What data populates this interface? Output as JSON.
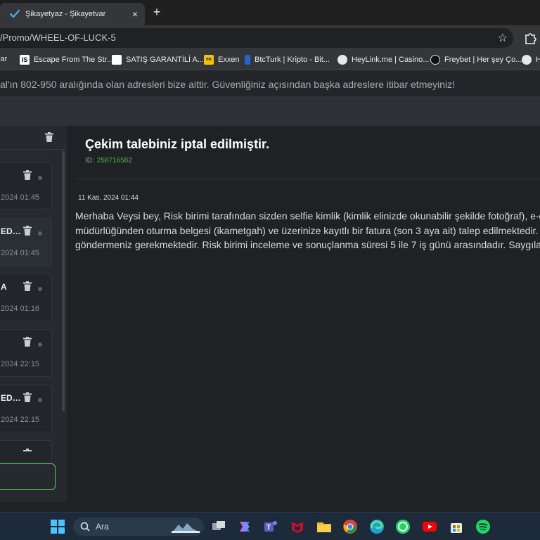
{
  "browser": {
    "tab_title": "Şikayetyaz - Şikayetvar",
    "tab_close": "×",
    "new_tab": "+",
    "url": "/Promo/WHEEL-OF-LUCK-5",
    "star": "☆"
  },
  "bookmarks": [
    {
      "label": "lar",
      "icon": "none"
    },
    {
      "label": "Escape From The Str...",
      "icon": "IS",
      "icon_bg": "#ffffff",
      "icon_fg": "#111111"
    },
    {
      "label": "SATIŞ GARANTİLİ A...",
      "icon": "",
      "icon_bg": "#ffffff",
      "icon_fg": "#111111"
    },
    {
      "label": "Exxen",
      "icon": "ex",
      "icon_bg": "#f2c500",
      "icon_fg": "#111111"
    },
    {
      "label": "BtcTurk | Kripto - Bit...",
      "icon": "",
      "icon_bg": "#2563c9",
      "icon_fg": "#ffffff"
    },
    {
      "label": "HeyLink.me | Casino...",
      "icon": "",
      "icon_bg": "#e8e8e8",
      "icon_fg": "#111111"
    },
    {
      "label": "Freybet | Her şey Ço...",
      "icon": "",
      "icon_bg": "#111111",
      "icon_fg": "#ffffff"
    },
    {
      "label": "H",
      "icon": "",
      "icon_bg": "#e8e8e8",
      "icon_fg": "#111111"
    }
  ],
  "notice": "al'ın 802-950 aralığında olan adresleri bize aittir. Güvenliğiniz açısından başka adreslere itibar etmeyiniz!",
  "sidebar": {
    "items": [
      {
        "title": "",
        "time": "2024 01:45",
        "active": false
      },
      {
        "title": "ED…",
        "time": "2024 01:45",
        "active": true
      },
      {
        "title": "A",
        "time": "2024 01:16",
        "active": false
      },
      {
        "title": "",
        "time": "2024 22:15",
        "active": false
      },
      {
        "title": "ED…",
        "time": "2024 22:15",
        "active": false
      },
      {
        "title": "",
        "time": "",
        "active": false
      }
    ]
  },
  "ticket": {
    "subject": "Çekim talebiniz iptal edilmiştir.",
    "id_label": "ID:",
    "id_value": "258716582",
    "date": "11 Kas, 2024 01:44",
    "body_lines": [
      "Merhaba Veysi bey, Risk birimi tarafından sizden selfie kimlik (kimlik elinizde okunabilir şekilde fotoğraf), e-dev",
      "müdürlüğünden oturma belgesi (ikametgah) ve üzerinize kayıtlı bir fatura (son 3 aya ait) talep edilmektedir. Bu",
      "göndermeniz gerekmektedir. Risk birimi inceleme ve sonuçlanma süresi 5 ile 7 iş günü arasındadır. Saygılarım"
    ]
  },
  "taskbar": {
    "search_label": "Ara"
  },
  "colors": {
    "accent_green": "#4fb24f",
    "box_green": "#5ac85a",
    "page_bg": "#1f2225"
  }
}
